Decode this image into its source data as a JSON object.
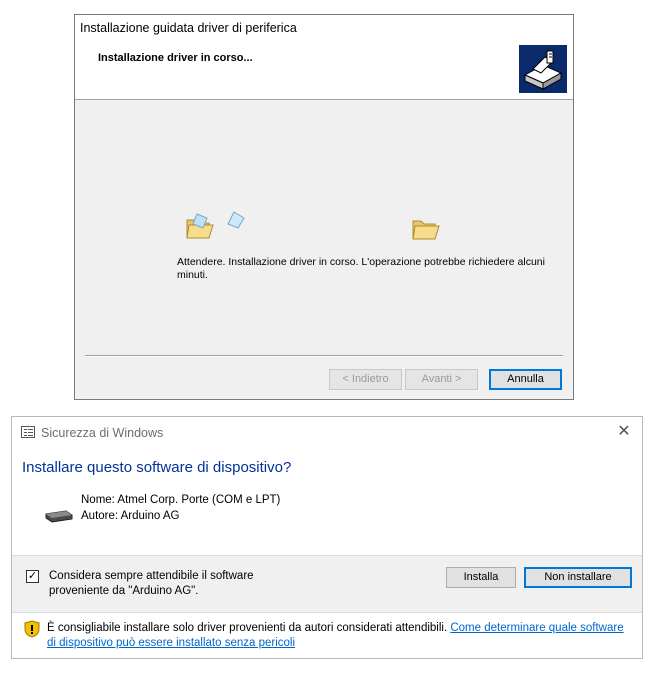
{
  "wizard": {
    "title": "Installazione guidata driver di periferica",
    "heading": "Installazione driver in corso...",
    "message": "Attendere. Installazione driver in corso. L'operazione potrebbe richiedere alcuni minuti.",
    "buttons": {
      "back_label": "< Indietro",
      "next_label": "Avanti >",
      "cancel_label": "Annulla"
    }
  },
  "security": {
    "title": "Sicurezza di Windows",
    "close_glyph": "✕",
    "question": "Installare questo software di dispositivo?",
    "name_line": "Nome: Atmel Corp. Porte (COM e LPT)",
    "author_line": "Autore: Arduino AG",
    "checkbox": {
      "checked": true,
      "label": "Considera sempre attendibile il software proveniente da \"Arduino AG\"."
    },
    "buttons": {
      "install_label": "Installa",
      "dont_install_label": "Non installare"
    },
    "footer": {
      "text": "È consigliabile installare solo driver provenienti da autori considerati attendibili. ",
      "link": "Come determinare quale software di dispositivo può essere installato senza pericoli"
    }
  },
  "colors": {
    "accent": "#0078d7",
    "question_text": "#003399",
    "link": "#0066cc"
  }
}
